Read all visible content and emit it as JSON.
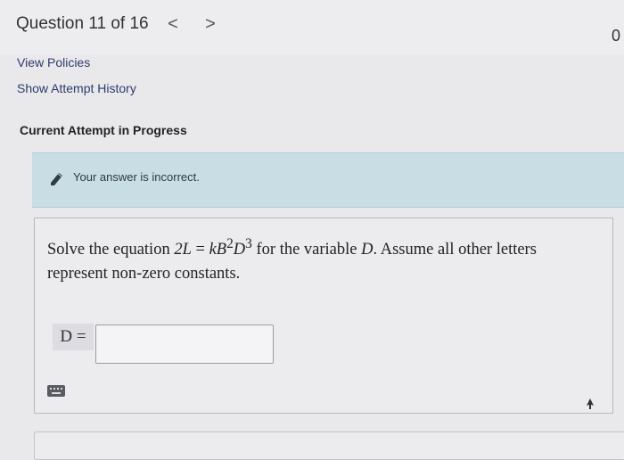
{
  "header": {
    "title": "Question 11 of 16",
    "prev_label": "<",
    "next_label": ">",
    "points": "0"
  },
  "links": {
    "view_policies": "View Policies",
    "show_attempt_history": "Show Attempt History"
  },
  "attempt": {
    "label": "Current Attempt in Progress"
  },
  "notice": {
    "icon": "pencil-icon",
    "text": "Your answer is incorrect."
  },
  "question": {
    "prefix": "Solve the equation ",
    "equation_lhs": "2L",
    "equals": " = ",
    "equation_rhs_k": "k",
    "equation_rhs_B": "B",
    "exp_B": "2",
    "equation_rhs_D": "D",
    "exp_D": "3",
    "middle": " for the variable ",
    "variable": "D",
    "suffix": ". Assume all other letters represent non-zero constants."
  },
  "answer": {
    "label": "D =",
    "value": ""
  },
  "icons": {
    "keyboard": "keyboard-icon",
    "cursor": "mouse-cursor-icon"
  }
}
